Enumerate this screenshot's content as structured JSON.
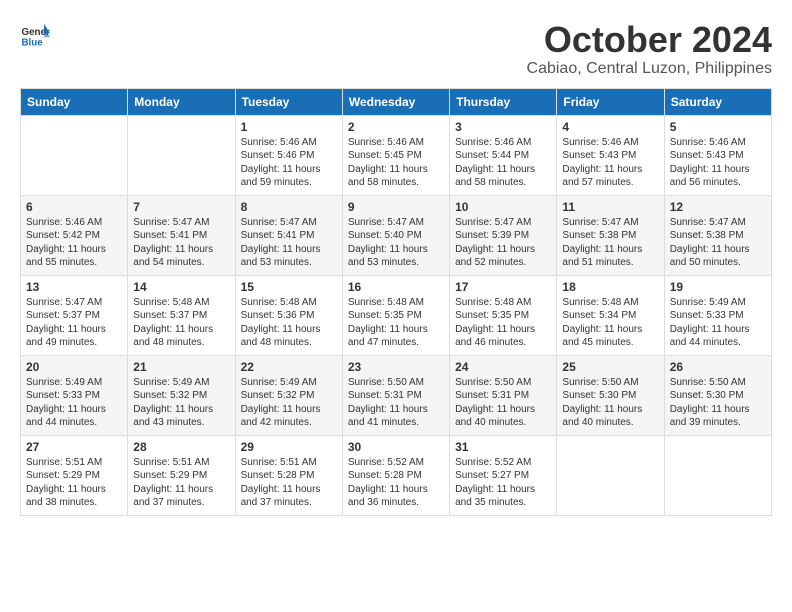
{
  "header": {
    "logo_line1": "General",
    "logo_line2": "Blue",
    "month": "October 2024",
    "location": "Cabiao, Central Luzon, Philippines"
  },
  "weekdays": [
    "Sunday",
    "Monday",
    "Tuesday",
    "Wednesday",
    "Thursday",
    "Friday",
    "Saturday"
  ],
  "weeks": [
    [
      {
        "day": "",
        "sunrise": "",
        "sunset": "",
        "daylight": ""
      },
      {
        "day": "",
        "sunrise": "",
        "sunset": "",
        "daylight": ""
      },
      {
        "day": "1",
        "sunrise": "Sunrise: 5:46 AM",
        "sunset": "Sunset: 5:46 PM",
        "daylight": "Daylight: 11 hours and 59 minutes."
      },
      {
        "day": "2",
        "sunrise": "Sunrise: 5:46 AM",
        "sunset": "Sunset: 5:45 PM",
        "daylight": "Daylight: 11 hours and 58 minutes."
      },
      {
        "day": "3",
        "sunrise": "Sunrise: 5:46 AM",
        "sunset": "Sunset: 5:44 PM",
        "daylight": "Daylight: 11 hours and 58 minutes."
      },
      {
        "day": "4",
        "sunrise": "Sunrise: 5:46 AM",
        "sunset": "Sunset: 5:43 PM",
        "daylight": "Daylight: 11 hours and 57 minutes."
      },
      {
        "day": "5",
        "sunrise": "Sunrise: 5:46 AM",
        "sunset": "Sunset: 5:43 PM",
        "daylight": "Daylight: 11 hours and 56 minutes."
      }
    ],
    [
      {
        "day": "6",
        "sunrise": "Sunrise: 5:46 AM",
        "sunset": "Sunset: 5:42 PM",
        "daylight": "Daylight: 11 hours and 55 minutes."
      },
      {
        "day": "7",
        "sunrise": "Sunrise: 5:47 AM",
        "sunset": "Sunset: 5:41 PM",
        "daylight": "Daylight: 11 hours and 54 minutes."
      },
      {
        "day": "8",
        "sunrise": "Sunrise: 5:47 AM",
        "sunset": "Sunset: 5:41 PM",
        "daylight": "Daylight: 11 hours and 53 minutes."
      },
      {
        "day": "9",
        "sunrise": "Sunrise: 5:47 AM",
        "sunset": "Sunset: 5:40 PM",
        "daylight": "Daylight: 11 hours and 53 minutes."
      },
      {
        "day": "10",
        "sunrise": "Sunrise: 5:47 AM",
        "sunset": "Sunset: 5:39 PM",
        "daylight": "Daylight: 11 hours and 52 minutes."
      },
      {
        "day": "11",
        "sunrise": "Sunrise: 5:47 AM",
        "sunset": "Sunset: 5:38 PM",
        "daylight": "Daylight: 11 hours and 51 minutes."
      },
      {
        "day": "12",
        "sunrise": "Sunrise: 5:47 AM",
        "sunset": "Sunset: 5:38 PM",
        "daylight": "Daylight: 11 hours and 50 minutes."
      }
    ],
    [
      {
        "day": "13",
        "sunrise": "Sunrise: 5:47 AM",
        "sunset": "Sunset: 5:37 PM",
        "daylight": "Daylight: 11 hours and 49 minutes."
      },
      {
        "day": "14",
        "sunrise": "Sunrise: 5:48 AM",
        "sunset": "Sunset: 5:37 PM",
        "daylight": "Daylight: 11 hours and 48 minutes."
      },
      {
        "day": "15",
        "sunrise": "Sunrise: 5:48 AM",
        "sunset": "Sunset: 5:36 PM",
        "daylight": "Daylight: 11 hours and 48 minutes."
      },
      {
        "day": "16",
        "sunrise": "Sunrise: 5:48 AM",
        "sunset": "Sunset: 5:35 PM",
        "daylight": "Daylight: 11 hours and 47 minutes."
      },
      {
        "day": "17",
        "sunrise": "Sunrise: 5:48 AM",
        "sunset": "Sunset: 5:35 PM",
        "daylight": "Daylight: 11 hours and 46 minutes."
      },
      {
        "day": "18",
        "sunrise": "Sunrise: 5:48 AM",
        "sunset": "Sunset: 5:34 PM",
        "daylight": "Daylight: 11 hours and 45 minutes."
      },
      {
        "day": "19",
        "sunrise": "Sunrise: 5:49 AM",
        "sunset": "Sunset: 5:33 PM",
        "daylight": "Daylight: 11 hours and 44 minutes."
      }
    ],
    [
      {
        "day": "20",
        "sunrise": "Sunrise: 5:49 AM",
        "sunset": "Sunset: 5:33 PM",
        "daylight": "Daylight: 11 hours and 44 minutes."
      },
      {
        "day": "21",
        "sunrise": "Sunrise: 5:49 AM",
        "sunset": "Sunset: 5:32 PM",
        "daylight": "Daylight: 11 hours and 43 minutes."
      },
      {
        "day": "22",
        "sunrise": "Sunrise: 5:49 AM",
        "sunset": "Sunset: 5:32 PM",
        "daylight": "Daylight: 11 hours and 42 minutes."
      },
      {
        "day": "23",
        "sunrise": "Sunrise: 5:50 AM",
        "sunset": "Sunset: 5:31 PM",
        "daylight": "Daylight: 11 hours and 41 minutes."
      },
      {
        "day": "24",
        "sunrise": "Sunrise: 5:50 AM",
        "sunset": "Sunset: 5:31 PM",
        "daylight": "Daylight: 11 hours and 40 minutes."
      },
      {
        "day": "25",
        "sunrise": "Sunrise: 5:50 AM",
        "sunset": "Sunset: 5:30 PM",
        "daylight": "Daylight: 11 hours and 40 minutes."
      },
      {
        "day": "26",
        "sunrise": "Sunrise: 5:50 AM",
        "sunset": "Sunset: 5:30 PM",
        "daylight": "Daylight: 11 hours and 39 minutes."
      }
    ],
    [
      {
        "day": "27",
        "sunrise": "Sunrise: 5:51 AM",
        "sunset": "Sunset: 5:29 PM",
        "daylight": "Daylight: 11 hours and 38 minutes."
      },
      {
        "day": "28",
        "sunrise": "Sunrise: 5:51 AM",
        "sunset": "Sunset: 5:29 PM",
        "daylight": "Daylight: 11 hours and 37 minutes."
      },
      {
        "day": "29",
        "sunrise": "Sunrise: 5:51 AM",
        "sunset": "Sunset: 5:28 PM",
        "daylight": "Daylight: 11 hours and 37 minutes."
      },
      {
        "day": "30",
        "sunrise": "Sunrise: 5:52 AM",
        "sunset": "Sunset: 5:28 PM",
        "daylight": "Daylight: 11 hours and 36 minutes."
      },
      {
        "day": "31",
        "sunrise": "Sunrise: 5:52 AM",
        "sunset": "Sunset: 5:27 PM",
        "daylight": "Daylight: 11 hours and 35 minutes."
      },
      {
        "day": "",
        "sunrise": "",
        "sunset": "",
        "daylight": ""
      },
      {
        "day": "",
        "sunrise": "",
        "sunset": "",
        "daylight": ""
      }
    ]
  ]
}
